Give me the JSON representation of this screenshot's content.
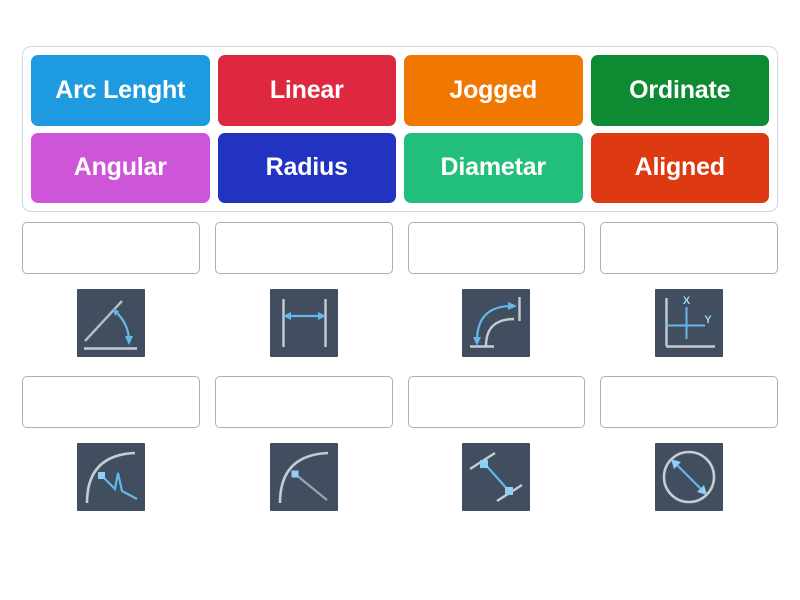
{
  "activity": {
    "type": "drag-and-drop-matching-quiz",
    "subject": "AutoCAD dimension types"
  },
  "tile_bank": {
    "tiles": [
      {
        "label": "Arc Lenght",
        "color": "#1E9BE0",
        "name": "tile-arc-lenght"
      },
      {
        "label": "Linear",
        "color": "#DE2840",
        "name": "tile-linear"
      },
      {
        "label": "Jogged",
        "color": "#F07800",
        "name": "tile-jogged"
      },
      {
        "label": "Ordinate",
        "color": "#0E8A33",
        "name": "tile-ordinate"
      },
      {
        "label": "Angular",
        "color": "#CC55D8",
        "name": "tile-angular"
      },
      {
        "label": "Radius",
        "color": "#2133C0",
        "name": "tile-radius"
      },
      {
        "label": "Diametar",
        "color": "#22BE7B",
        "name": "tile-diametar"
      },
      {
        "label": "Aligned",
        "color": "#DD3A12",
        "name": "tile-aligned"
      }
    ]
  },
  "answer_slots": [
    {
      "dropzone_value": "",
      "image": "angular-dimension-icon",
      "image_bg": "#414e5f",
      "stroke": "#c8ccd2",
      "accent": "#63b8e8"
    },
    {
      "dropzone_value": "",
      "image": "linear-dimension-icon",
      "image_bg": "#414e5f",
      "stroke": "#c8ccd2",
      "accent": "#63b8e8"
    },
    {
      "dropzone_value": "",
      "image": "arc-length-dimension-icon",
      "image_bg": "#414e5f",
      "stroke": "#c8ccd2",
      "accent": "#63b8e8"
    },
    {
      "dropzone_value": "",
      "image": "ordinate-dimension-icon",
      "image_bg": "#414e5f",
      "stroke": "#c8ccd2",
      "accent": "#63b8e8",
      "labels": {
        "x": "X",
        "y": "Y"
      }
    },
    {
      "dropzone_value": "",
      "image": "jogged-radius-dimension-icon",
      "image_bg": "#414e5f",
      "stroke": "#c8ccd2",
      "accent": "#63b8e8"
    },
    {
      "dropzone_value": "",
      "image": "radius-dimension-icon",
      "image_bg": "#414e5f",
      "stroke": "#c8ccd2",
      "accent": "#63b8e8"
    },
    {
      "dropzone_value": "",
      "image": "aligned-dimension-icon",
      "image_bg": "#414e5f",
      "stroke": "#c8ccd2",
      "accent": "#63b8e8"
    },
    {
      "dropzone_value": "",
      "image": "diameter-dimension-icon",
      "image_bg": "#414e5f",
      "stroke": "#c8ccd2",
      "accent": "#63b8e8"
    }
  ],
  "colors": {
    "page_background": "#ffffff",
    "bank_border": "#d3d7dd",
    "dropzone_border": "#aab0b7",
    "thumb_background": "#414e5f",
    "thumb_stroke": "#c8ccd2",
    "thumb_accent": "#63b8e8"
  }
}
